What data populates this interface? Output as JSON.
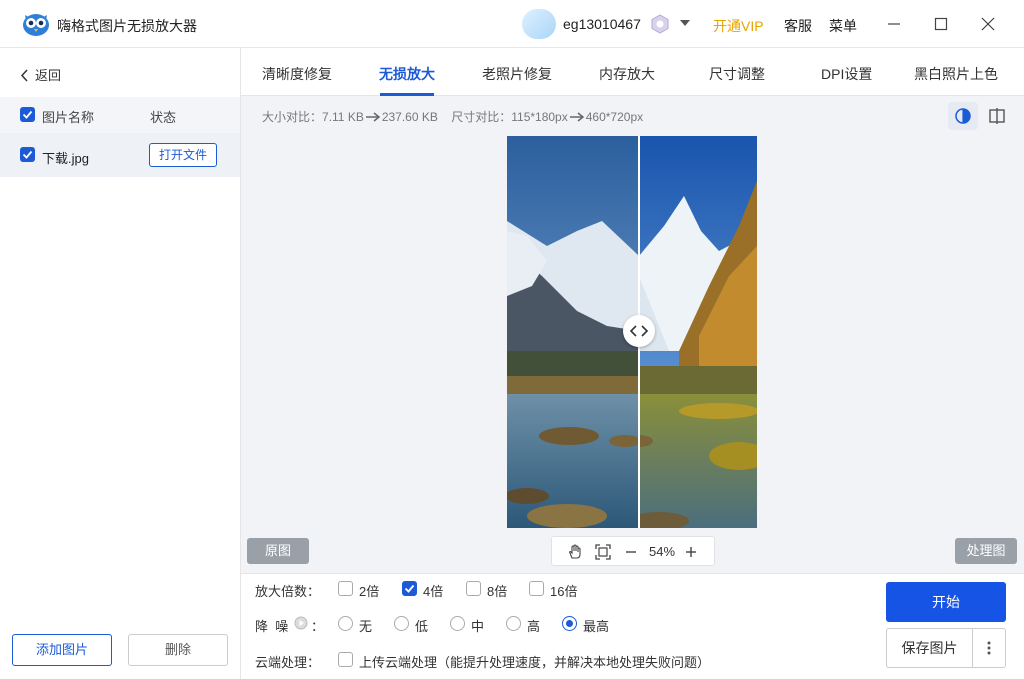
{
  "app": {
    "title": "嗨格式图片无损放大器"
  },
  "user": {
    "name": "eg13010467"
  },
  "header": {
    "vip_label": "开通VIP",
    "service_label": "客服",
    "menu_label": "菜单"
  },
  "sidebar": {
    "back_label": "返回",
    "list_header": {
      "name": "图片名称",
      "status": "状态"
    },
    "files": [
      {
        "name": "下载.jpg",
        "action": "打开文件",
        "checked": true
      }
    ],
    "add_label": "添加图片",
    "delete_label": "删除"
  },
  "tabs": [
    {
      "label": "清晰度修复",
      "active": false
    },
    {
      "label": "无损放大",
      "active": true
    },
    {
      "label": "老照片修复",
      "active": false
    },
    {
      "label": "内存放大",
      "active": false
    },
    {
      "label": "尺寸调整",
      "active": false
    },
    {
      "label": "DPI设置",
      "active": false
    },
    {
      "label": "黑白照片上色",
      "active": false
    }
  ],
  "compare": {
    "size_label": "大小对比：",
    "size_before": "7.11 KB",
    "size_after": "237.60 KB",
    "dim_label": "尺寸对比：",
    "dim_before": "115*180px",
    "dim_after": "460*720px"
  },
  "preview": {
    "original_label": "原图",
    "processed_label": "处理图",
    "zoom": "54%"
  },
  "options": {
    "scale_label": "放大倍数：",
    "scale_options": [
      {
        "label": "2倍",
        "checked": false
      },
      {
        "label": "4倍",
        "checked": true
      },
      {
        "label": "8倍",
        "checked": false
      },
      {
        "label": "16倍",
        "checked": false
      }
    ],
    "denoise_label_1": "降",
    "denoise_label_2": "噪",
    "denoise_suffix": "：",
    "denoise_options": [
      {
        "label": "无",
        "selected": false
      },
      {
        "label": "低",
        "selected": false
      },
      {
        "label": "中",
        "selected": false
      },
      {
        "label": "高",
        "selected": false
      },
      {
        "label": "最高",
        "selected": true
      }
    ],
    "cloud_label": "云端处理：",
    "cloud_option": "上传云端处理（能提升处理速度，并解决本地处理失败问题）"
  },
  "actions": {
    "start_label": "开始",
    "save_label": "保存图片"
  },
  "colors": {
    "accent": "#1c5bd6",
    "vip": "#e6a500",
    "start": "#1654e6"
  }
}
